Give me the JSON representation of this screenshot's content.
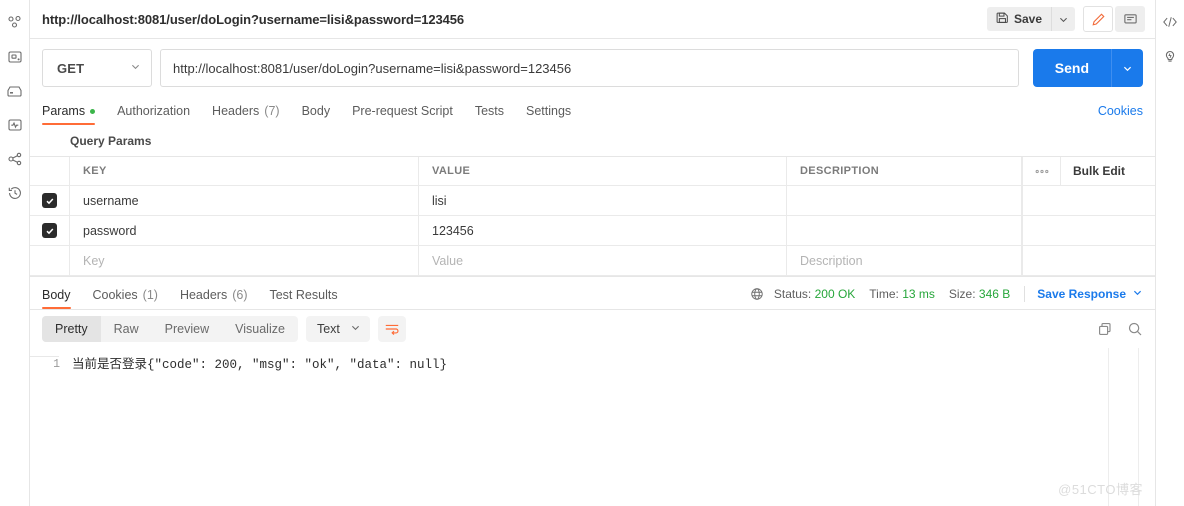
{
  "left_rail": {
    "items": [
      {
        "name": "collections-icon",
        "label": "Collections"
      },
      {
        "name": "console-icon",
        "label": "Console"
      },
      {
        "name": "apis-icon",
        "label": "APIs"
      },
      {
        "name": "monitors-icon",
        "label": "Monitors"
      },
      {
        "name": "flows-icon",
        "label": "Flows"
      },
      {
        "name": "history-icon",
        "label": "History"
      }
    ]
  },
  "right_rail": {
    "items": [
      {
        "name": "code-icon",
        "label": "Code snippet"
      },
      {
        "name": "lightbulb-icon",
        "label": "Info"
      }
    ]
  },
  "topbar": {
    "request_title": "http://localhost:8081/user/doLogin?username=lisi&password=123456",
    "save_label": "Save",
    "save_caret": "⌄",
    "edit_icon": "pencil-icon",
    "comment_icon": "comment-icon"
  },
  "url_row": {
    "method": "GET",
    "method_caret": "⌄",
    "url": "http://localhost:8081/user/doLogin?username=lisi&password=123456",
    "send_label": "Send",
    "send_caret": "⌄"
  },
  "request_tabs": {
    "tabs": [
      {
        "label": "Params",
        "selected": true,
        "dot": true,
        "count": ""
      },
      {
        "label": "Authorization",
        "selected": false,
        "dot": false,
        "count": ""
      },
      {
        "label": "Headers",
        "selected": false,
        "dot": false,
        "count": "(7)"
      },
      {
        "label": "Body",
        "selected": false,
        "dot": false,
        "count": ""
      },
      {
        "label": "Pre-request Script",
        "selected": false,
        "dot": false,
        "count": ""
      },
      {
        "label": "Tests",
        "selected": false,
        "dot": false,
        "count": ""
      },
      {
        "label": "Settings",
        "selected": false,
        "dot": false,
        "count": ""
      }
    ],
    "cookies_link": "Cookies"
  },
  "params": {
    "section_label": "Query Params",
    "columns": [
      "KEY",
      "VALUE",
      "DESCRIPTION"
    ],
    "dots_label": "●●●",
    "bulk_edit_label": "Bulk Edit",
    "rows": [
      {
        "checked": true,
        "key": "username",
        "value": "lisi",
        "description": ""
      },
      {
        "checked": true,
        "key": "password",
        "value": "123456",
        "description": ""
      }
    ],
    "placeholder_row": {
      "key": "Key",
      "value": "Value",
      "description": "Description"
    }
  },
  "response": {
    "tabs": [
      {
        "label": "Body",
        "count": "",
        "selected": true
      },
      {
        "label": "Cookies",
        "count": "(1)",
        "selected": false
      },
      {
        "label": "Headers",
        "count": "(6)",
        "selected": false
      },
      {
        "label": "Test Results",
        "count": "",
        "selected": false
      }
    ],
    "status_label": "Status:",
    "status_value": "200 OK",
    "time_label": "Time:",
    "time_value": "13 ms",
    "size_label": "Size:",
    "size_value": "346 B",
    "save_response_label": "Save Response",
    "save_response_caret": "⌄",
    "globe_icon": "globe-icon"
  },
  "body_toolbar": {
    "views": [
      {
        "label": "Pretty",
        "selected": true
      },
      {
        "label": "Raw",
        "selected": false
      },
      {
        "label": "Preview",
        "selected": false
      },
      {
        "label": "Visualize",
        "selected": false
      }
    ],
    "format": "Text",
    "format_caret": "⌄",
    "wrap_icon": "wrap-lines-icon",
    "copy_icon": "copy-icon",
    "search_icon": "search-icon"
  },
  "body_content": {
    "line_number": "1",
    "text": "当前是否登录{\"code\": 200, \"msg\": \"ok\", \"data\": null}"
  },
  "watermark": "@51CTO博客",
  "colors": {
    "accent_orange": "#ff6c37",
    "link_blue": "#1a7aeb",
    "send_blue": "#1a7aeb",
    "status_green": "#26a63a",
    "border": "#e6e6e6"
  }
}
